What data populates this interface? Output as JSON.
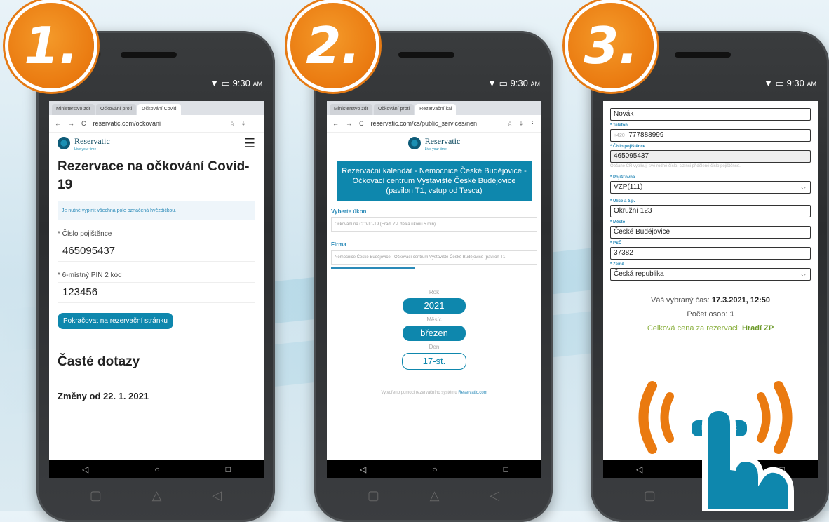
{
  "steps": [
    "1.",
    "2.",
    "3."
  ],
  "phone_status": {
    "time": "9:30",
    "ampm": "AM"
  },
  "nav": {
    "back": "◁",
    "home": "○",
    "recent": "□"
  },
  "screen1": {
    "tabs": [
      "Ministerstvo zdr",
      "Očkování proti",
      "Očkování Covid"
    ],
    "url": "reservatic.com/ockovani",
    "logo": {
      "name": "Reservatic",
      "tagline": "Live your time"
    },
    "title": "Rezervace na očkování Covid-19",
    "notice": "Je nutné vyplnit všechna pole označená hvězdičkou.",
    "field1_label": "Číslo pojištěnce",
    "field1_value": "465095437",
    "field2_label": "6-místný PIN 2 kód",
    "field2_value": "123456",
    "continue_button": "Pokračovat na rezervační stránku",
    "faq_title": "Časté dotazy",
    "changes_title": "Změny od 22. 1. 2021"
  },
  "screen2": {
    "tabs": [
      "Ministerstvo zdr",
      "Očkování proti",
      "Rezervační kal"
    ],
    "url": "reservatic.com/cs/public_services/nen",
    "logo": {
      "name": "Reservatic",
      "tagline": "Live your time"
    },
    "calendar_title": "Rezervační kalendář - Nemocnice České Budějovice - Očkovací centrum Výstaviště České Budějovice (pavilon T1, vstup od Tesca)",
    "service_label": "Vyberte úkon",
    "service_value": "Očkování na COVID-19 (Hradí ZP, délka úkonu 5 min)",
    "company_label": "Firma",
    "company_value": "Nemocnice České Budějovice - Očkovací centrum Výstaviště České Budějovice (pavilon T1",
    "year_label": "Rok",
    "year_value": "2021",
    "month_label": "Měsíc",
    "month_value": "březen",
    "day_label": "Den",
    "day_value": "17-st.",
    "powered_text": "Vytvořeno pomocí rezervačního systému",
    "powered_link": "Reservatic.com"
  },
  "screen3": {
    "surname_value": "Novák",
    "phone_label": "* Telefon",
    "phone_prefix": "+420",
    "phone_value": "777888999",
    "insurance_no_label": "* Číslo pojištěnce",
    "insurance_no_value": "465095437",
    "insurance_hint": "Občané ČR vyplňují své rodné číslo, cizinci přidělené číslo pojištěnce.",
    "insurer_label": "* Pojišťovna",
    "insurer_value": "VZP(111)",
    "street_label": "* Ulice a č.p.",
    "street_value": "Okružní 123",
    "city_label": "* Město",
    "city_value": "České Budějovice",
    "zip_label": "* PSČ",
    "zip_value": "37382",
    "country_label": "* Země",
    "country_value": "Česká republika",
    "summary_time_prefix": "Váš vybraný čas:",
    "summary_time_value": "17.3.2021, 12:50",
    "summary_persons_prefix": "Počet osob:",
    "summary_persons_value": "1",
    "summary_price_prefix": "Celková cena za rezervaci:",
    "summary_price_value": "Hradí ZP",
    "reserve_button": "Rezervovat"
  },
  "colors": {
    "accent": "#0e87ad",
    "badge": "#ea7a10",
    "green": "#8bb040"
  }
}
